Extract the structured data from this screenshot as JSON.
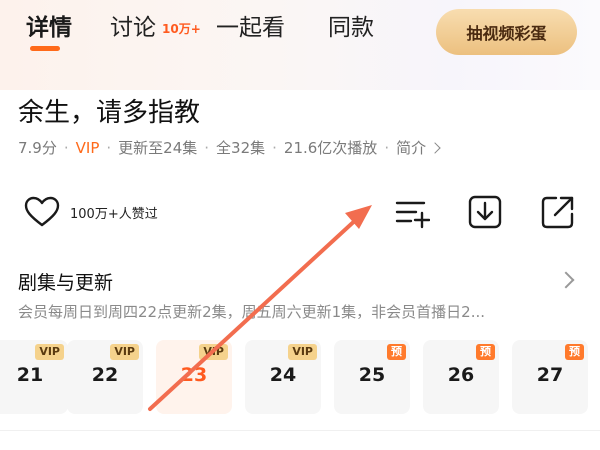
{
  "tabs": [
    {
      "label": "详情",
      "active": true
    },
    {
      "label": "讨论",
      "badge": "10万+"
    },
    {
      "label": "一起看"
    },
    {
      "label": "同款"
    }
  ],
  "egg_button": "抽视频彩蛋",
  "show": {
    "title": "余生，请多指教",
    "rating": "7.9分",
    "vip": "VIP",
    "update_status": "更新至24集",
    "total": "全32集",
    "plays": "21.6亿次播放",
    "intro": "简介"
  },
  "actions": {
    "like_count": "100万+人赞过",
    "icons": [
      "heart-icon",
      "add-to-playlist-icon",
      "download-icon",
      "share-icon"
    ]
  },
  "episodes_section": {
    "title": "剧集与更新",
    "description": "会员每周日到周四22点更新2集，周五周六更新1集，非会员首播日2..."
  },
  "episodes": [
    {
      "number": "21",
      "badge": "VIP",
      "badge_type": "vip"
    },
    {
      "number": "22",
      "badge": "VIP",
      "badge_type": "vip"
    },
    {
      "number": "23",
      "badge": "VIP",
      "badge_type": "vip",
      "current": true
    },
    {
      "number": "24",
      "badge": "VIP",
      "badge_type": "vip"
    },
    {
      "number": "25",
      "badge": "预",
      "badge_type": "pre"
    },
    {
      "number": "26",
      "badge": "预",
      "badge_type": "pre"
    },
    {
      "number": "27",
      "badge": "预",
      "badge_type": "pre"
    }
  ],
  "colors": {
    "accent": "#ff6a1a",
    "vip_badge": "#f5d28c",
    "preview_badge": "#ff7a2c",
    "annotation_arrow": "#f26d4f"
  }
}
